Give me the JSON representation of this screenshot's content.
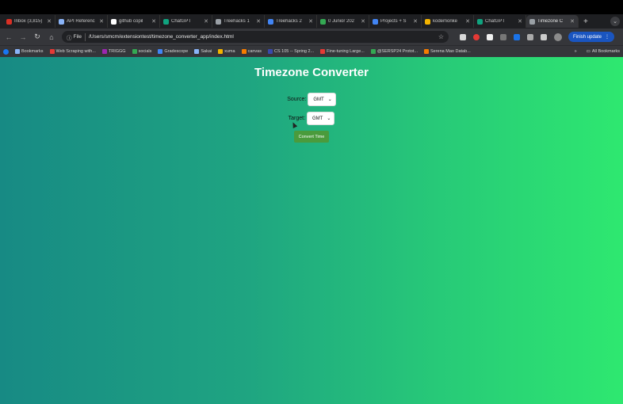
{
  "browser": {
    "tabs": [
      {
        "title": "Inbox (3,815)",
        "color": "#d93025"
      },
      {
        "title": "API Referenc",
        "color": "#8ab4f8"
      },
      {
        "title": "github copil",
        "color": "#ffffff"
      },
      {
        "title": "ChatGPT",
        "color": "#10a37f"
      },
      {
        "title": "Treehacks 1",
        "color": "#9aa0a6"
      },
      {
        "title": "Treehacks 2",
        "color": "#4285f4"
      },
      {
        "title": "0 Junior 202",
        "color": "#34a853"
      },
      {
        "title": "Projects + S",
        "color": "#4285f4"
      },
      {
        "title": "kodemonke",
        "color": "#f4b400"
      },
      {
        "title": "ChatGPT",
        "color": "#10a37f"
      },
      {
        "title": "Timezone C",
        "color": "#9aa0a6",
        "active": true
      }
    ],
    "new_tab": "+",
    "tab_menu": "⌄",
    "nav": {
      "back": "←",
      "forward": "→",
      "reload": "↻",
      "home": "⌂"
    },
    "address_bar": {
      "scheme_label": "File",
      "url": "/Users/smcm/extensiontest/timezone_converter_app/index.html",
      "star": "☆"
    },
    "update_button": {
      "label": "Finish update",
      "menu": "⋮"
    },
    "bookmarks": [
      {
        "label": "Bookmarks",
        "color": "#8ab4f8"
      },
      {
        "label": "Web Scraping with...",
        "color": "#e53935"
      },
      {
        "label": "TRIGGG",
        "color": "#9c27b0"
      },
      {
        "label": "socials",
        "color": "#34a853"
      },
      {
        "label": "Gradescope",
        "color": "#4285f4"
      },
      {
        "label": "Sakai",
        "color": "#8ab4f8"
      },
      {
        "label": "xuma",
        "color": "#f4b400"
      },
      {
        "label": "canvas",
        "color": "#f57c00"
      },
      {
        "label": "CS 105 -- Spring 2...",
        "color": "#3949ab"
      },
      {
        "label": "Fine-tuning Large...",
        "color": "#e53935"
      },
      {
        "label": "@SERSP24 Protot...",
        "color": "#34a853"
      },
      {
        "label": "Serena Mao Datab...",
        "color": "#f57c00"
      }
    ],
    "bookmarks_more": "»",
    "all_bookmarks": "All Bookmarks"
  },
  "app": {
    "title": "Timezone Converter",
    "source_label": "Source:",
    "source_value": "GMT",
    "target_label": "Target:",
    "target_value": "GMT",
    "convert_label": "Convert Time"
  }
}
